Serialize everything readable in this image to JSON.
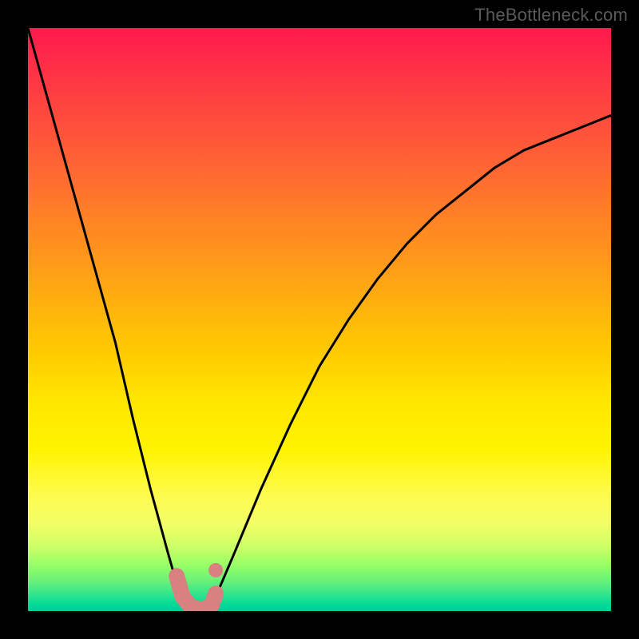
{
  "attribution": "TheBottleneck.com",
  "chart_data": {
    "type": "line",
    "title": "",
    "xlabel": "",
    "ylabel": "",
    "xlim": [
      0,
      100
    ],
    "ylim": [
      0,
      100
    ],
    "background_gradient": {
      "orientation": "vertical",
      "stops": [
        {
          "pct": 0,
          "color": "#ff1a4d"
        },
        {
          "pct": 50,
          "color": "#ffcc00"
        },
        {
          "pct": 80,
          "color": "#fffb4d"
        },
        {
          "pct": 100,
          "color": "#00cc99"
        }
      ]
    },
    "series": [
      {
        "name": "bottleneck-curve",
        "x": [
          0,
          5,
          10,
          15,
          18,
          21,
          24,
          26,
          27.5,
          29,
          32,
          35,
          40,
          45,
          50,
          55,
          60,
          65,
          70,
          75,
          80,
          85,
          90,
          95,
          100
        ],
        "values": [
          100,
          82,
          64,
          46,
          33,
          21,
          10,
          3,
          0.5,
          0,
          2,
          9,
          21,
          32,
          42,
          50,
          57,
          63,
          68,
          72,
          76,
          79,
          81,
          83,
          85
        ]
      }
    ],
    "markers": [
      {
        "name": "left-dot",
        "x": 25.5,
        "y": 6.0,
        "color": "#d98080",
        "size": 18
      },
      {
        "name": "right-dot",
        "x": 32.2,
        "y": 7.0,
        "color": "#d98080",
        "size": 18
      },
      {
        "name": "min-dot",
        "x": 30.5,
        "y": 0.0,
        "color": "#000000",
        "size": 8
      },
      {
        "name": "min-ring",
        "x": 30.5,
        "y": 0.8,
        "color": "#d98080",
        "size": 14
      }
    ],
    "annotations": [
      {
        "name": "bottom-u-shape",
        "type": "thick-path",
        "color": "#d98080",
        "width": 20,
        "points_xy": [
          [
            25.5,
            6.0
          ],
          [
            26.5,
            2.5
          ],
          [
            28.0,
            0.6
          ],
          [
            30.0,
            0.2
          ],
          [
            31.5,
            1.0
          ],
          [
            32.2,
            3.0
          ]
        ]
      }
    ]
  }
}
